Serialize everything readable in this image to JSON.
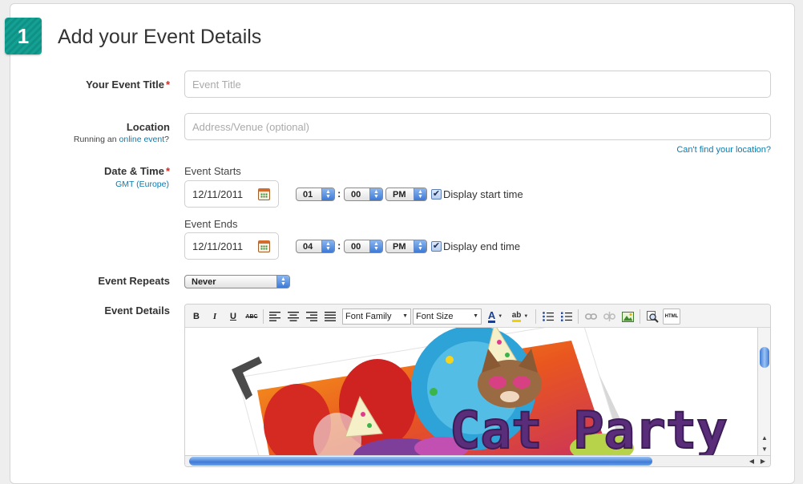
{
  "step": {
    "number": "1",
    "title": "Add your Event Details"
  },
  "event_title": {
    "label": "Your Event Title",
    "required_mark": "*",
    "placeholder": "Event Title"
  },
  "location": {
    "label": "Location",
    "placeholder": "Address/Venue (optional)",
    "hint_prefix": "Running an ",
    "hint_link": "online event",
    "hint_suffix": "?",
    "cant_find_link": "Can't find your location?"
  },
  "date_time": {
    "label": "Date & Time",
    "required_mark": "*",
    "timezone_link": "GMT (Europe)",
    "start": {
      "caption": "Event Starts",
      "date": "12/11/2011",
      "hour": "01",
      "minute": "00",
      "ampm": "PM",
      "display_label": "Display start time",
      "display_checked": "✔"
    },
    "end": {
      "caption": "Event Ends",
      "date": "12/11/2011",
      "hour": "04",
      "minute": "00",
      "ampm": "PM",
      "display_label": "Display end time",
      "display_checked": "✔"
    },
    "colon": ":"
  },
  "repeats": {
    "label": "Event Repeats",
    "value": "Never"
  },
  "details": {
    "label": "Event Details",
    "toolbar": {
      "bold": "B",
      "italic": "I",
      "underline": "U",
      "strike": "ABC",
      "font_family": "Font Family",
      "font_size": "Font Size",
      "font_color": "A",
      "highlight": "ab",
      "html": "HTML"
    },
    "image_text": "Cat Party"
  },
  "colors": {
    "accent": "#14a093",
    "link": "#0a7bb0",
    "required": "#d9261c",
    "image_text": "#5a2d7a"
  }
}
